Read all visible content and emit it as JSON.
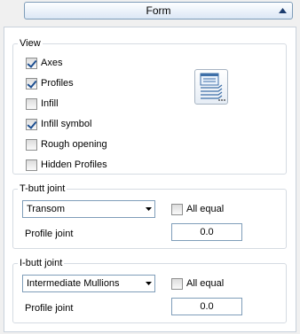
{
  "header": {
    "title": "Form",
    "collapse_icon": "triangle-up-icon"
  },
  "view": {
    "title": "View",
    "options": [
      {
        "label": "Axes",
        "checked": true
      },
      {
        "label": "Profiles",
        "checked": true
      },
      {
        "label": "Infill",
        "checked": false
      },
      {
        "label": "Infill symbol",
        "checked": true
      },
      {
        "label": "Rough opening",
        "checked": false
      },
      {
        "label": "Hidden Profiles",
        "checked": false
      }
    ],
    "settings_icon": "layers-settings-icon"
  },
  "t_butt": {
    "title": "T-butt joint",
    "select_value": "Transom",
    "all_equal_label": "All equal",
    "all_equal_checked": false,
    "profile_joint_label": "Profile joint",
    "profile_joint_value": "0.0"
  },
  "i_butt": {
    "title": "I-butt joint",
    "select_value": "Intermediate Mullions",
    "all_equal_label": "All equal",
    "all_equal_checked": false,
    "profile_joint_label": "Profile joint",
    "profile_joint_value": "0.0"
  }
}
